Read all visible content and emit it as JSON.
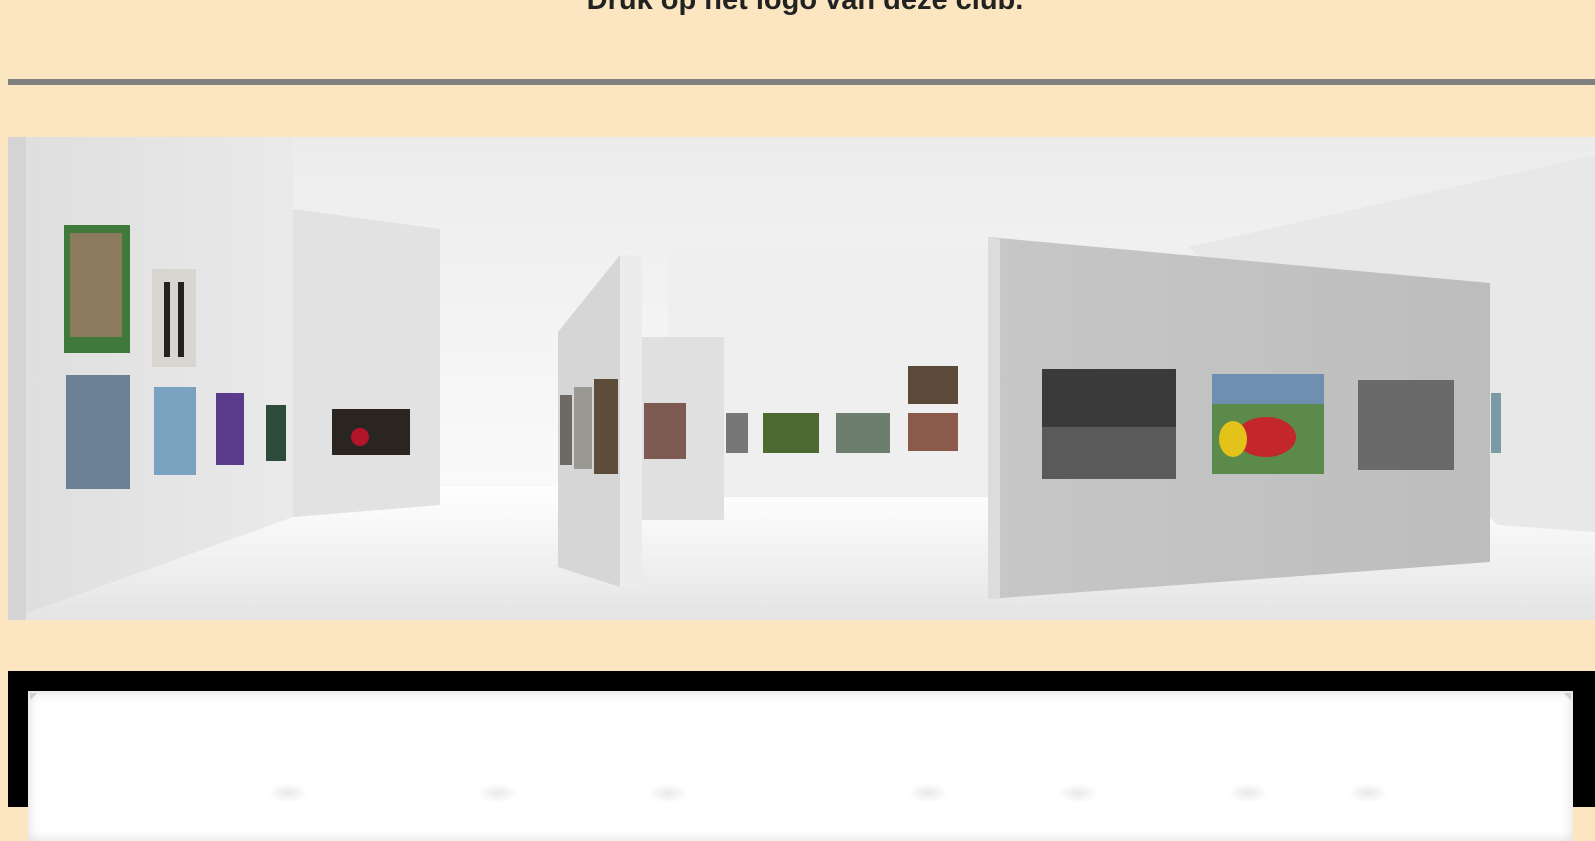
{
  "header": {
    "instruction": "Druk op het logo van deze club."
  },
  "colors": {
    "page_background": "#fbe6c1",
    "divider": "#7e817e",
    "bottom_frame": "#000000"
  },
  "gallery": {
    "description_icon": "virtual-3d-gallery-icon"
  }
}
